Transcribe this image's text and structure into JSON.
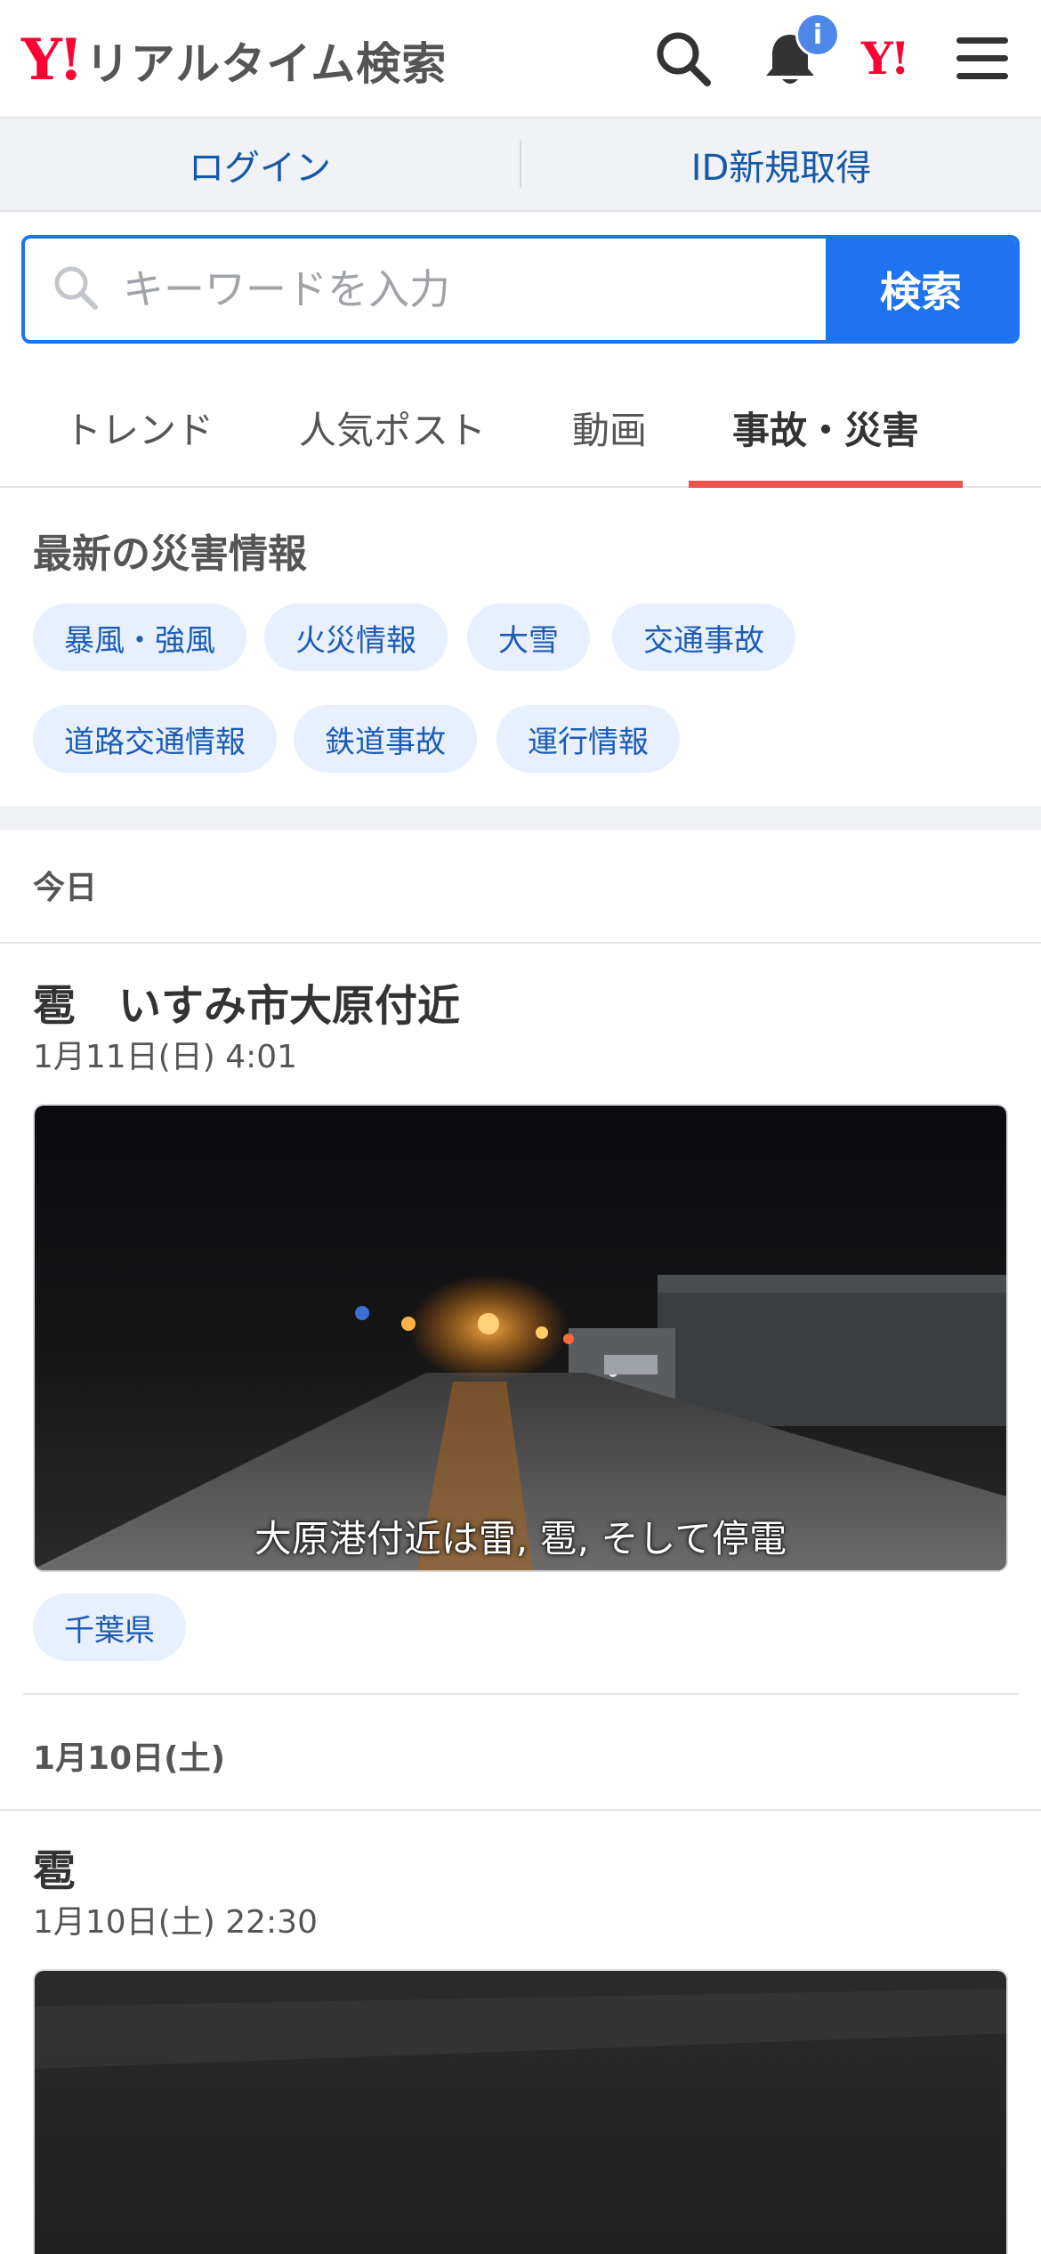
{
  "header": {
    "logo_mark": "Y!",
    "logo_text": "リアルタイム検索",
    "notification_badge": "i",
    "yahoo_mark": "Y!"
  },
  "account": {
    "login_label": "ログイン",
    "signup_label": "ID新規取得"
  },
  "search": {
    "placeholder": "キーワードを入力",
    "value": "",
    "button_label": "検索"
  },
  "tabs": [
    {
      "label": "トレンド",
      "active": false
    },
    {
      "label": "人気ポスト",
      "active": false
    },
    {
      "label": "動画",
      "active": false
    },
    {
      "label": "事故・災害",
      "active": true
    }
  ],
  "disaster": {
    "title": "最新の災害情報",
    "categories": [
      "暴風・強風",
      "火災情報",
      "大雪",
      "交通事故",
      "道路交通情報",
      "鉄道事故",
      "運行情報"
    ]
  },
  "feed": {
    "groups": [
      {
        "date_label": "今日",
        "post": {
          "title": "雹　いすみ市大原付近",
          "time": "1月11日(日) 4:01",
          "caption": "大原港付近は雷, 雹, そして停電",
          "tag": "千葉県"
        }
      },
      {
        "date_label": "1月10日(土)",
        "post": {
          "title": "雹",
          "time": "1月10日(土) 22:30"
        }
      }
    ]
  },
  "colors": {
    "brand_red": "#ff0033",
    "accent_blue": "#1e74f0",
    "link_blue": "#1558a8",
    "tab_underline": "#e9554a",
    "chip_bg": "#e8f0fd"
  }
}
